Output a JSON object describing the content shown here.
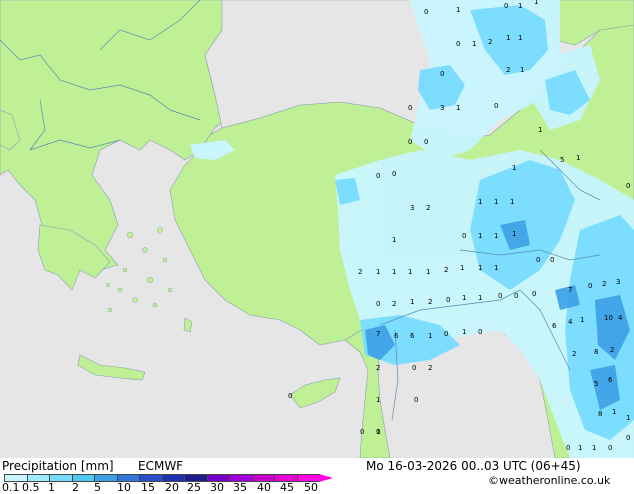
{
  "title": "Precipitation [mm]",
  "model": "ECMWF",
  "datetime": "Mo 16-03-2026 00..03 UTC (06+45)",
  "credit": "©weatheronline.co.uk",
  "scale": {
    "labels": [
      "0.1",
      "0.5",
      "1",
      "2",
      "5",
      "10",
      "15",
      "20",
      "25",
      "30",
      "35",
      "40",
      "45",
      "50"
    ],
    "colors": [
      "#c8f5ff",
      "#a0ebff",
      "#78dcff",
      "#50c8f0",
      "#3ca0e6",
      "#3278dc",
      "#2850c8",
      "#1e32b4",
      "#1e1e8c",
      "#7800c8",
      "#a000dc",
      "#c800c8",
      "#e600d2",
      "#ff00e6"
    ]
  },
  "colors": {
    "sea": "#e6e6e6",
    "land": "#c0f096",
    "precip_light": "#c8f5ff",
    "precip_mid": "#78dcff",
    "precip_heavy": "#3ca0e6",
    "border": "#5a8ab4"
  },
  "grid_values": [
    {
      "v": "0"
    },
    {
      "v": "1"
    },
    {
      "v": "0"
    },
    {
      "v": "1"
    },
    {
      "v": "1"
    },
    {
      "v": "2"
    },
    {
      "v": "1"
    },
    {
      "v": "1"
    },
    {
      "v": "0"
    },
    {
      "v": "1"
    },
    {
      "v": "0"
    },
    {
      "v": "2"
    },
    {
      "v": "1"
    },
    {
      "v": "0"
    },
    {
      "v": "3"
    },
    {
      "v": "1"
    },
    {
      "v": "0"
    },
    {
      "v": "0"
    },
    {
      "v": "0"
    },
    {
      "v": "1"
    },
    {
      "v": "5"
    },
    {
      "v": "1"
    },
    {
      "v": "0"
    },
    {
      "v": "0"
    },
    {
      "v": "1"
    },
    {
      "v": "0"
    },
    {
      "v": "3"
    },
    {
      "v": "2"
    },
    {
      "v": "1"
    },
    {
      "v": "1"
    },
    {
      "v": "1"
    },
    {
      "v": "1"
    },
    {
      "v": "0"
    },
    {
      "v": "1"
    },
    {
      "v": "1"
    },
    {
      "v": "1"
    },
    {
      "v": "2"
    },
    {
      "v": "1"
    },
    {
      "v": "1"
    },
    {
      "v": "1"
    },
    {
      "v": "1"
    },
    {
      "v": "2"
    },
    {
      "v": "1"
    },
    {
      "v": "1"
    },
    {
      "v": "1"
    },
    {
      "v": "0"
    },
    {
      "v": "0"
    },
    {
      "v": "0"
    },
    {
      "v": "2"
    },
    {
      "v": "1"
    },
    {
      "v": "2"
    },
    {
      "v": "0"
    },
    {
      "v": "1"
    },
    {
      "v": "1"
    },
    {
      "v": "0"
    },
    {
      "v": "0"
    },
    {
      "v": "0"
    },
    {
      "v": "7"
    },
    {
      "v": "0"
    },
    {
      "v": "2"
    },
    {
      "v": "3"
    },
    {
      "v": "7"
    },
    {
      "v": "6"
    },
    {
      "v": "6"
    },
    {
      "v": "1"
    },
    {
      "v": "0"
    },
    {
      "v": "1"
    },
    {
      "v": "0"
    },
    {
      "v": "6"
    },
    {
      "v": "4"
    },
    {
      "v": "1"
    },
    {
      "v": "10"
    },
    {
      "v": "4"
    },
    {
      "v": "2"
    },
    {
      "v": "0"
    },
    {
      "v": "2"
    },
    {
      "v": "8"
    },
    {
      "v": "2"
    },
    {
      "v": "2"
    },
    {
      "v": "5"
    },
    {
      "v": "6"
    },
    {
      "v": "0"
    },
    {
      "v": "0"
    },
    {
      "v": "1"
    },
    {
      "v": "8"
    },
    {
      "v": "1"
    },
    {
      "v": "1"
    },
    {
      "v": "0"
    },
    {
      "v": "0"
    },
    {
      "v": "1"
    },
    {
      "v": "1"
    },
    {
      "v": "0"
    },
    {
      "v": "0"
    },
    {
      "v": "0"
    },
    {
      "v": "1"
    }
  ]
}
